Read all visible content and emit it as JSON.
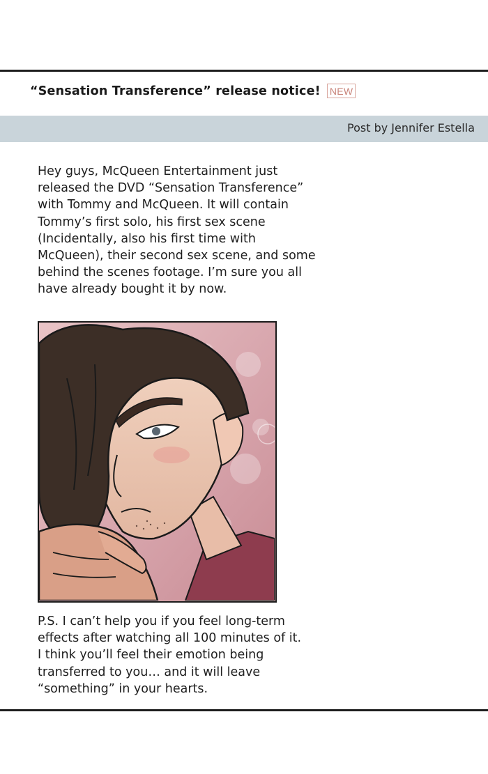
{
  "post": {
    "title": "“Sensation Transference” release notice!",
    "badge": "NEW",
    "author": "Post by Jennifer Estella",
    "body": "Hey guys, McQueen Entertainment just\nreleased the DVD “Sensation Transference”\nwith Tommy and McQueen. It will contain\nTommy’s first solo, his first sex scene\n(Incidentally, also his first time with\nMcQueen), their second sex scene, and some\nbehind the scenes footage. I’m sure you all\nhave already bought it by now.",
    "ps": "P.S. I can’t help you if you feel long-term\neffects after watching all 100 minutes of it.\nI think you’ll feel their emotion being\ntransferred to you… and it will leave\n“something” in your hearts."
  },
  "colors": {
    "author_bar": "#c9d4da",
    "badge": "#c9847a",
    "rule": "#1e1e1e",
    "illustration_bg": "#d7a9ae"
  },
  "illustration": {
    "subject": "dark-haired man with hand to chin, pink bokeh background"
  }
}
